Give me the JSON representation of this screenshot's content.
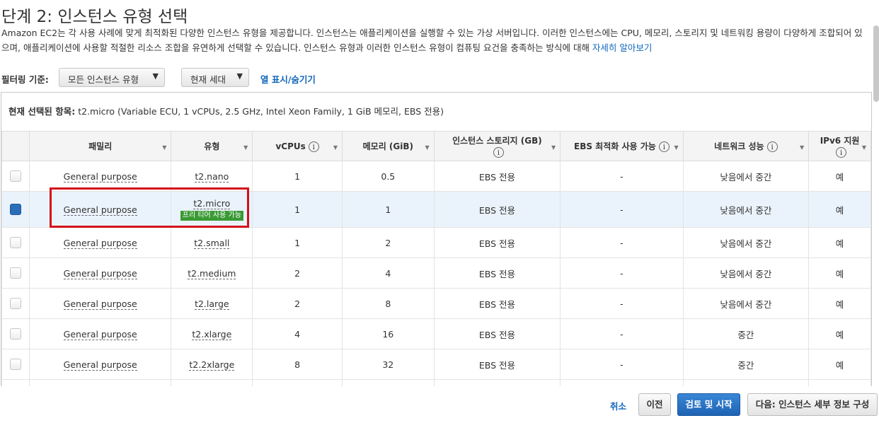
{
  "page": {
    "title": "단계 2: 인스턴스 유형 선택",
    "desc_text": "Amazon EC2는 각 사용 사례에 맞게 최적화된 다양한 인스턴스 유형을 제공합니다. 인스턴스는 애플리케이션을 실행할 수 있는 가상 서버입니다. 이러한 인스턴스에는 CPU, 메모리, 스토리지 및 네트워킹 용량이 다양하게 조합되어 있으며, 애플리케이션에 사용할 적절한 리소스 조합을 유연하게 선택할 수 있습니다. 인스턴스 유형과 이러한 인스턴스 유형이 컴퓨팅 요건을 충족하는 방식에 대해 ",
    "desc_link": "자세히 알아보기"
  },
  "filter": {
    "label": "필터링 기준:",
    "type_select": "모든 인스턴스 유형",
    "gen_select": "현재 세대",
    "toggle_columns": "열 표시/숨기기"
  },
  "selection": {
    "label": "현재 선택된 항목:",
    "value": "t2.micro (Variable ECU, 1 vCPUs, 2.5 GHz, Intel Xeon Family, 1 GiB 메모리, EBS 전용)"
  },
  "columns": {
    "family": "패밀리",
    "type": "유형",
    "vcpus": "vCPUs",
    "memory": "메모리 (GiB)",
    "storage": "인스턴스 스토리지 (GB)",
    "ebs": "EBS 최적화 사용 가능",
    "network": "네트워크 성능",
    "ipv6": "IPv6 지원"
  },
  "rows": [
    {
      "family": "General purpose",
      "type": "t2.nano",
      "vcpus": "1",
      "memory": "0.5",
      "storage": "EBS 전용",
      "ebs": "-",
      "network": "낮음에서 중간",
      "ipv6": "예",
      "checked": false
    },
    {
      "family": "General purpose",
      "type": "t2.micro",
      "badge": "프리 티어 사용 가능",
      "vcpus": "1",
      "memory": "1",
      "storage": "EBS 전용",
      "ebs": "-",
      "network": "낮음에서 중간",
      "ipv6": "예",
      "checked": true
    },
    {
      "family": "General purpose",
      "type": "t2.small",
      "vcpus": "1",
      "memory": "2",
      "storage": "EBS 전용",
      "ebs": "-",
      "network": "낮음에서 중간",
      "ipv6": "예",
      "checked": false
    },
    {
      "family": "General purpose",
      "type": "t2.medium",
      "vcpus": "2",
      "memory": "4",
      "storage": "EBS 전용",
      "ebs": "-",
      "network": "낮음에서 중간",
      "ipv6": "예",
      "checked": false
    },
    {
      "family": "General purpose",
      "type": "t2.large",
      "vcpus": "2",
      "memory": "8",
      "storage": "EBS 전용",
      "ebs": "-",
      "network": "낮음에서 중간",
      "ipv6": "예",
      "checked": false
    },
    {
      "family": "General purpose",
      "type": "t2.xlarge",
      "vcpus": "4",
      "memory": "16",
      "storage": "EBS 전용",
      "ebs": "-",
      "network": "중간",
      "ipv6": "예",
      "checked": false
    },
    {
      "family": "General purpose",
      "type": "t2.2xlarge",
      "vcpus": "8",
      "memory": "32",
      "storage": "EBS 전용",
      "ebs": "-",
      "network": "중간",
      "ipv6": "예",
      "checked": false
    }
  ],
  "buttons": {
    "cancel": "취소",
    "previous": "이전",
    "review_launch": "검토 및 시작",
    "next": "다음: 인스턴스 세부 정보 구성"
  },
  "colors": {
    "link": "#1166bb",
    "highlight": "#d3101c",
    "badge": "#3a9a35",
    "primary": "#1e63b4"
  }
}
